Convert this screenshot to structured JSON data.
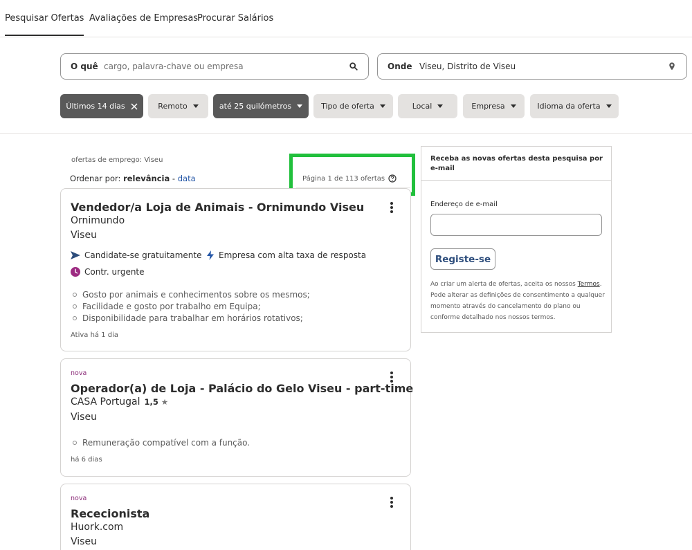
{
  "nav": {
    "tabs": [
      {
        "label": "Pesquisar Ofertas",
        "active": true
      },
      {
        "label": "Avaliações de Empresas"
      },
      {
        "label": "Procurar Salários"
      }
    ]
  },
  "search": {
    "what_label": "O quê",
    "what_placeholder": "cargo, palavra-chave ou empresa",
    "what_value": "",
    "where_label": "Onde",
    "where_value": "Viseu, Distrito de Viseu"
  },
  "filters": [
    {
      "label": "Últimos 14 dias",
      "active": true,
      "icon": "close-icon"
    },
    {
      "label": "Remoto",
      "icon": "caret-down-icon"
    },
    {
      "label": "até 25 quilómetros",
      "active": true,
      "icon": "caret-down-icon"
    },
    {
      "label": "Tipo de oferta",
      "icon": "caret-down-icon"
    },
    {
      "label": "Local",
      "icon": "caret-down-icon"
    },
    {
      "label": "Empresa",
      "icon": "caret-down-icon"
    },
    {
      "label": "Idioma da oferta",
      "icon": "caret-down-icon"
    }
  ],
  "results": {
    "meta": "ofertas de emprego: Viseu",
    "sort_prefix": "Ordenar por:",
    "sort_active": "relevância",
    "sort_sep": "-",
    "sort_alt": "data",
    "page_info": "Página 1 de 113 ofertas"
  },
  "jobs": [
    {
      "tag": "",
      "title": "Vendedor/a Loja de Animais - Ornimundo Viseu",
      "company": "Ornimundo",
      "rating": "",
      "location": "Viseu",
      "attrs": [
        {
          "icon": "send-icon",
          "label": "Candidate-se gratuitamente"
        },
        {
          "icon": "lightning-icon",
          "label": "Empresa com alta taxa de resposta"
        },
        {
          "icon": "clock-icon",
          "label": "Contr. urgente"
        }
      ],
      "bullets": [
        "Gosto por animais e conhecimentos sobre os mesmos;",
        "Facilidade e gosto por trabalho em Equipa;",
        "Disponibilidade para trabalhar em horários rotativos;"
      ],
      "age": "Ativa há 1 dia"
    },
    {
      "tag": "nova",
      "title": "Operador(a) de Loja - Palácio do Gelo Viseu - part-time",
      "company": "CASA Portugal",
      "rating": "1,5",
      "location": "Viseu",
      "attrs": [],
      "bullets": [
        "Remuneração compatível com a função."
      ],
      "age": "há 6 dias"
    },
    {
      "tag": "nova",
      "title": "Rececionista",
      "company": "Huork.com",
      "rating": "",
      "location": "Viseu",
      "attrs": [],
      "bullets": [],
      "age": ""
    }
  ],
  "alert": {
    "heading": "Receba as novas ofertas desta pesquisa por e-mail",
    "email_label": "Endereço de e-mail",
    "email_value": "",
    "button": "Registe-se",
    "legal_before": "Ao criar um alerta de ofertas, aceita os nossos ",
    "legal_link": "Termos",
    "legal_after": ". Pode alterar as definições de consentimento a qualquer momento através do cancelamento do plano ou conforme detalhado nos nossos termos."
  },
  "colors": {
    "accent_link": "#2557a7",
    "nova_tag": "#8b2b78",
    "highlight_box": "#21c03c",
    "chip_active": "#595959",
    "chip_default": "#e4e2e0"
  }
}
